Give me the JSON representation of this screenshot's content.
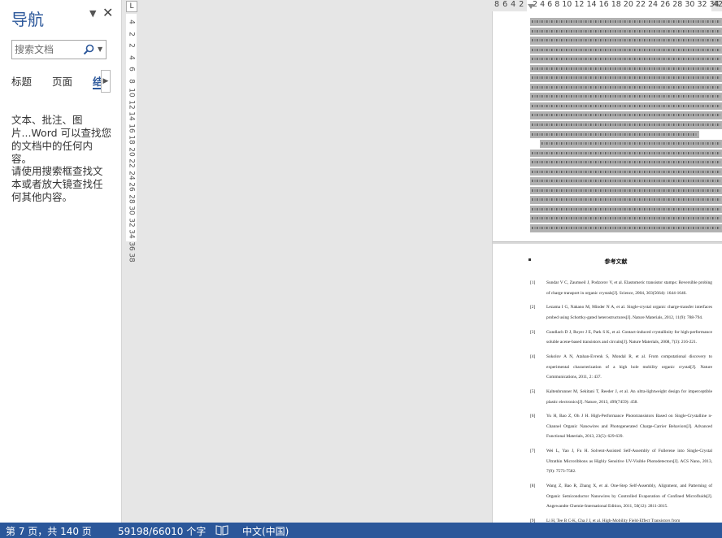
{
  "nav": {
    "title": "导航",
    "search_placeholder": "搜索文档",
    "tabs": [
      "标题",
      "页面",
      "结果"
    ],
    "message1": "文本、批注、图片...Word 可以查找您的文档中的任何内容。",
    "message2": "请使用搜索框查找文本或者放大镜查找任何其他内容。",
    "dropdown_glyph": "▼",
    "close_glyph": "✕",
    "scroll_glyph": "▶"
  },
  "ruler": {
    "corner": "L",
    "vertical_ticks": [
      "4",
      "2",
      "2",
      "4",
      "6",
      "8",
      "10",
      "12",
      "14",
      "16",
      "18",
      "20",
      "22",
      "24",
      "26",
      "28",
      "30",
      "32",
      "34",
      "36",
      "38"
    ],
    "h_left": "8 6 4 2",
    "h_numbers": "2  4  6  8 10 12 14 16 18 20 22 24 26 28 30 32 34 36 38",
    "h_end": "42"
  },
  "doc": {
    "ref_heading": "参考文献",
    "references": [
      {
        "num": "[1]",
        "text": "Sundar V C, Zaumseil J, Podzorov V, et al. Elastomeric transistor stamps: Reversible probing of charge transport in organic crystals[J]. Science, 2004, 303(5664): 1644-1646."
      },
      {
        "num": "[2]",
        "text": "Lezama I G, Nakano M, Minder N A, et al. Single-crystal organic charge-transfer interfaces probed using Schottky-gated heterostructures[J]. Nature Materials, 2012, 11(9): 788-794."
      },
      {
        "num": "[3]",
        "text": "Gundlach D J, Royer J E, Park S K, et al. Contact-induced crystallinity for high-performance soluble acene-based transistors and circuits[J]. Nature Materials, 2008, 7(3): 216-221."
      },
      {
        "num": "[4]",
        "text": "Sokolov A N, Atahan-Evrenk S, Mondal R, et al. From computational discovery to experimental characterization of a high hole mobility organic crystal[J]. Nature Communications, 2011, 2: 437."
      },
      {
        "num": "[5]",
        "text": "Kaltenbrunner M, Sekitani T, Reeder J, et al. An ultra-lightweight design for imperceptible plastic electronics[J]. Nature, 2013, 499(7459): 458."
      },
      {
        "num": "[6]",
        "text": "Yu H, Bao Z, Oh J H. High-Performance Phototransistors Based on Single-Crystalline n-Channel Organic Nanowires and Photogenerated Charge-Carrier Behaviors[J]. Advanced Functional Materials, 2013, 23(5): 629-639."
      },
      {
        "num": "[7]",
        "text": "Wei L, Yao J, Fu H. Solvent-Assisted Self-Assembly of Fullerene into Single-Crystal Ultrathin Microribbons as Highly Sensitive UV-Visible Photodetectors[J]. ACS Nano, 2013, 7(9): 7573-7582."
      },
      {
        "num": "[8]",
        "text": "Wang Z, Bao R, Zhang X, et al. One-Step Self-Assembly, Alignment, and Patterning of Organic Semiconductor Nanowires by Controlled Evaporation of Confined Microfluids[J]. Angewandte Chemie-International Edition, 2011, 50(12): 2811-2815."
      },
      {
        "num": "[9]",
        "text": "Li H, Tee B C-K, Cha J J, et al. High-Mobility Field-Effect Transistors from"
      }
    ]
  },
  "status": {
    "page": "第 7 页，共 140 页",
    "words": "59198/66010 个字",
    "language": "中文(中国)"
  },
  "colors": {
    "accent": "#2b579a",
    "selection": "#b2b2b2"
  }
}
